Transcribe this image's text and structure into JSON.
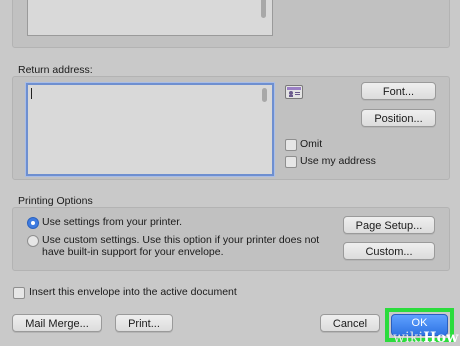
{
  "return_address": {
    "heading": "Return address:",
    "value": "",
    "font_button": "Font...",
    "position_button": "Position...",
    "omit_label": "Omit",
    "use_my_address_label": "Use my address"
  },
  "printing_options": {
    "heading": "Printing Options",
    "radio_printer_label": "Use settings from your printer.",
    "radio_custom_line1": "Use custom settings. Use this option if your printer does not",
    "radio_custom_line2": "have built-in support for your envelope.",
    "page_setup_button": "Page Setup...",
    "custom_button": "Custom..."
  },
  "insert_label": "Insert this envelope into the active document",
  "footer": {
    "mail_merge_button": "Mail Merge...",
    "print_button": "Print...",
    "cancel_button": "Cancel",
    "ok_button": "OK"
  },
  "watermark": {
    "wiki": "wiki",
    "how": "How"
  },
  "colors": {
    "highlight": "#2bdc3c",
    "primary": "#2f73e3",
    "focus": "#6e8fd0"
  },
  "icons": {
    "address_book": "address-book-icon"
  }
}
